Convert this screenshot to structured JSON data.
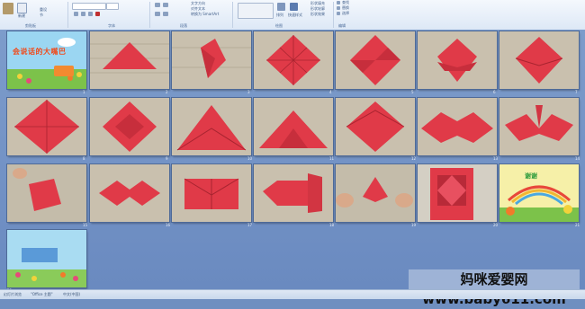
{
  "ribbon": {
    "groups": [
      {
        "label": "剪贴板"
      },
      {
        "label": "字体"
      },
      {
        "label": "段落"
      },
      {
        "label": "绘图"
      },
      {
        "label": "编辑"
      }
    ],
    "buttons": {
      "new_slide": "新建",
      "reset": "重设",
      "section": "节",
      "text_direction": "文字方向",
      "align_text": "对齐文本",
      "smartart": "转换为 SmartArt",
      "arrange": "排列",
      "quick_styles": "快速样式",
      "shape_fill": "形状填充",
      "shape_outline": "形状轮廓",
      "shape_effects": "形状效果",
      "find": "查找",
      "replace": "替换",
      "select": "选择"
    }
  },
  "slides": [
    {
      "num": "1",
      "kind": "title",
      "title": "会说话的大嘴巴"
    },
    {
      "num": "2",
      "kind": "photo"
    },
    {
      "num": "3",
      "kind": "photo"
    },
    {
      "num": "4",
      "kind": "photo"
    },
    {
      "num": "5",
      "kind": "photo"
    },
    {
      "num": "6",
      "kind": "photo"
    },
    {
      "num": "7",
      "kind": "photo"
    },
    {
      "num": "8",
      "kind": "photo"
    },
    {
      "num": "9",
      "kind": "photo"
    },
    {
      "num": "10",
      "kind": "photo"
    },
    {
      "num": "11",
      "kind": "photo"
    },
    {
      "num": "12",
      "kind": "photo"
    },
    {
      "num": "13",
      "kind": "photo"
    },
    {
      "num": "14",
      "kind": "photo"
    },
    {
      "num": "15",
      "kind": "photo"
    },
    {
      "num": "16",
      "kind": "photo"
    },
    {
      "num": "17",
      "kind": "photo"
    },
    {
      "num": "18",
      "kind": "photo"
    },
    {
      "num": "19",
      "kind": "photo"
    },
    {
      "num": "20",
      "kind": "photo"
    },
    {
      "num": "21",
      "kind": "cartoon",
      "title": "谢谢"
    },
    {
      "num": "22",
      "kind": "end"
    }
  ],
  "status": {
    "slide_sorter": "幻灯片浏览",
    "theme": "\"Office 主题\"",
    "language": "中文(中国)"
  },
  "watermark": "妈咪爱婴网 www.baby611.com",
  "colors": {
    "canvas": "#7293c6",
    "paper": "#e03a48",
    "wood": "#c8c0b0"
  }
}
